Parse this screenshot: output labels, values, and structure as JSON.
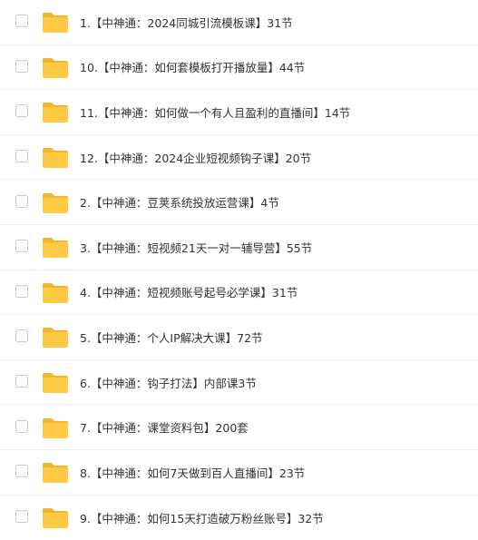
{
  "colors": {
    "folder": "#FFCB45",
    "folder_tab": "#F2B52E",
    "text": "#333333",
    "divider": "#EEEEEE"
  },
  "files": [
    {
      "name": "1.【中神通：2024同城引流模板课】31节"
    },
    {
      "name": "10.【中神通：如何套模板打开播放量】44节"
    },
    {
      "name": "11.【中神通：如何做一个有人且盈利的直播间】14节"
    },
    {
      "name": "12.【中神通：2024企业短视频钩子课】20节"
    },
    {
      "name": "2.【中神通：豆荚系统投放运营课】4节"
    },
    {
      "name": "3.【中神通：短视频21天一对一辅导营】55节"
    },
    {
      "name": "4.【中神通：短视频账号起号必学课】31节"
    },
    {
      "name": "5.【中神通：个人IP解决大课】72节"
    },
    {
      "name": "6.【中神通：钩子打法】内部课3节"
    },
    {
      "name": "7.【中神通：课堂资料包】200套"
    },
    {
      "name": "8.【中神通：如何7天做到百人直播间】23节"
    },
    {
      "name": "9.【中神通：如何15天打造破万粉丝账号】32节"
    }
  ]
}
